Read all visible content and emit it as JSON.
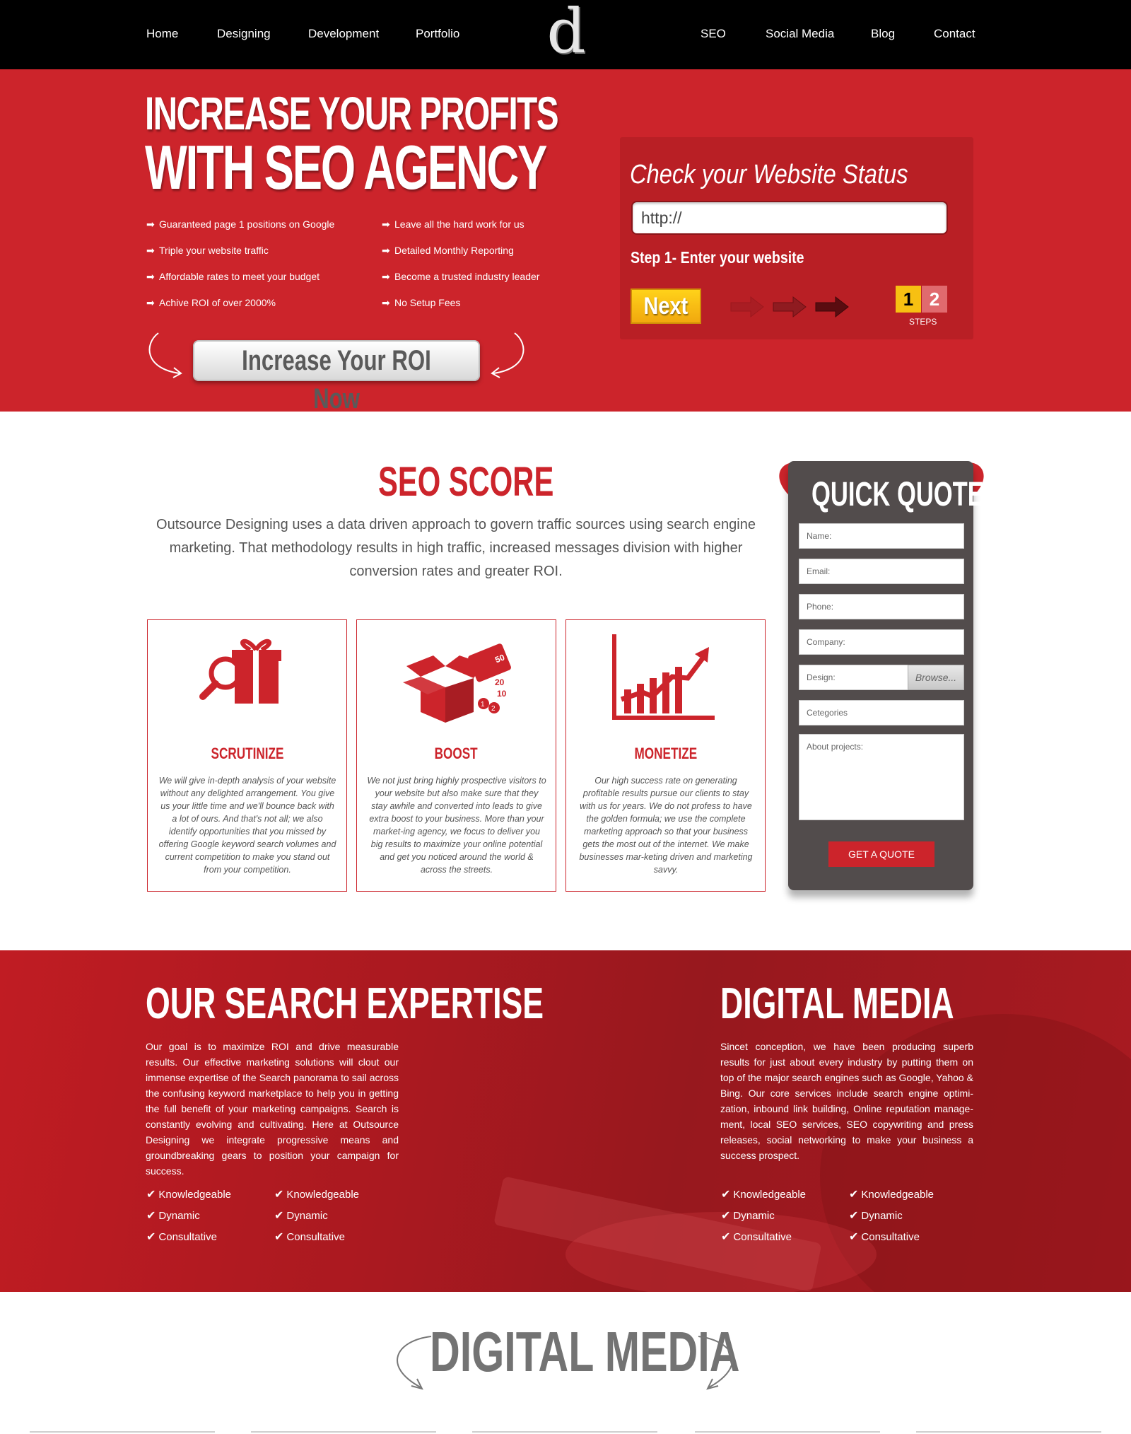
{
  "nav": {
    "left": [
      "Home",
      "Designing",
      "Development",
      "Portfolio"
    ],
    "right": [
      "SEO",
      "Social Media",
      "Blog",
      "Contact"
    ],
    "logo": "d"
  },
  "hero": {
    "title_line1": "INCREASE YOUR PROFITS",
    "title_line2": "WITH SEO AGENCY",
    "features_left": [
      "Guaranteed page 1 positions on Google",
      "Triple your website traffic",
      "Affordable rates to meet your budget",
      "Achive ROI of over 2000%"
    ],
    "features_right": [
      "Leave all the hard work for us",
      "Detailed Monthly Reporting",
      "Become a trusted industry leader",
      "No Setup Fees"
    ],
    "cta": "Increase Your ROI Now"
  },
  "status": {
    "title": "Check your Website Status",
    "url_value": "http://",
    "step_label": "Step 1- Enter your website",
    "next": "Next",
    "step1": "1",
    "step2": "2",
    "steps_label": "STEPS"
  },
  "seo": {
    "title": "SEO SCORE",
    "description": "Outsource Designing uses a data driven approach to govern traffic sources using search engine marketing. That methodology results in high traffic, increased messages division with higher conversion rates and greater ROI.",
    "cards": [
      {
        "icon": "magnifier-gift-icon",
        "title": "SCRUTINIZE",
        "text": "We will give in-depth analysis of your website without any delighted arrangement. You give us your little time and we'll bounce back with a lot of ours. And that's not all; we also identify opportunities that you missed by offering Google keyword search volumes and current competition to make you stand out from your competition."
      },
      {
        "icon": "box-tickets-icon",
        "title": "BOOST",
        "text": "We not just bring highly prospective visitors to your website but also make sure that they stay awhile and converted into leads to give extra boost to your business. More than your market-ing agency, we focus to deliver you big results to maximize your online potential and get you noticed around the world & across the streets."
      },
      {
        "icon": "growth-chart-icon",
        "title": "MONETIZE",
        "text": "Our high success rate on generating profitable results pursue our clients to stay with us for years. We do not profess to have the golden formula; we use the complete marketing approach so that your business gets the most out of the internet. We make businesses mar-keting driven and marketing savvy."
      }
    ]
  },
  "quote": {
    "title": "QUICK QUOTE",
    "fields": [
      "Name:",
      "Email:",
      "Phone:",
      "Company:",
      "Design:",
      "Cetegories"
    ],
    "browse": "Browse...",
    "about": "About projects:",
    "button": "GET A QUOTE"
  },
  "expertise": {
    "left_title": "OUR SEARCH EXPERTISE",
    "left_text": "Our goal is to maximize ROI and drive measurable results. Our effective marketing solutions will clout our immense expertise of the Search panorama to sail across the confusing keyword marketplace to help you in getting the full benefit of your marketing campaigns. Search is constantly evolving and cultivating. Here at Outsource Designing we integrate progressive means and groundbreaking gears to position your campaign for success.",
    "right_title": "DIGITAL MEDIA",
    "right_text": "Sincet conception, we have been producing superb results for just about every industry by putting them on top of the major search engines such as Google, Yahoo & Bing. Our core services include search engine optimi-zation, inbound link building, Online reputation manage-ment, local SEO services, SEO copywriting and press releases, social networking to make your business a success prospect.",
    "checks": [
      "Knowledgeable",
      "Dynamic",
      "Consultative"
    ]
  },
  "digital_media": {
    "title": "DIGITAL MEDIA"
  },
  "colors": {
    "brand_red": "#cc242b",
    "nav_bg": "#000000",
    "quote_bg": "#524c4c",
    "next_yellow": "#f7c012"
  }
}
